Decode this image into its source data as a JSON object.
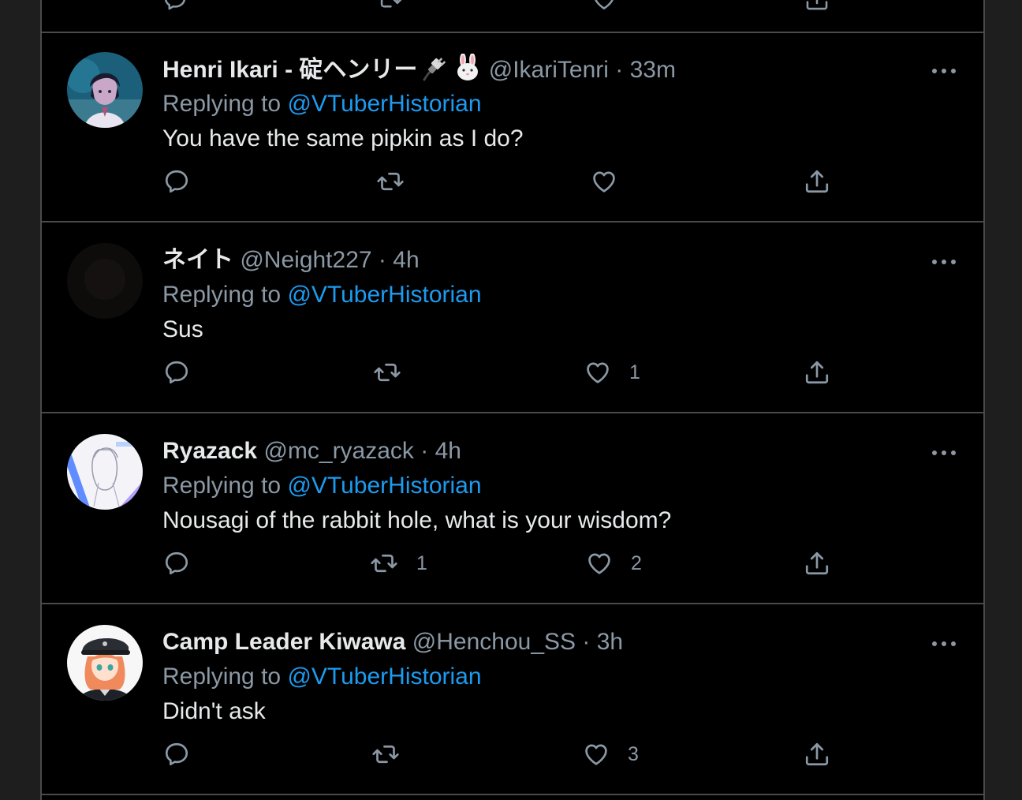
{
  "tweets": [
    {
      "display_name": "Henri Ikari - 碇ヘンリー",
      "emojis": [
        "plug-emoji",
        "rabbit-face-emoji"
      ],
      "handle": "@IkariTenri",
      "sep": "·",
      "time": "33m",
      "replying_prefix": "Replying to",
      "replying_to": "@VTuberHistorian",
      "text": "You have the same pipkin as I do?",
      "reply_count": "",
      "retweet_count": "",
      "like_count": ""
    },
    {
      "display_name": "ネイト",
      "handle": "@Neight227",
      "sep": "·",
      "time": "4h",
      "replying_prefix": "Replying to",
      "replying_to": "@VTuberHistorian",
      "text": "Sus",
      "reply_count": "",
      "retweet_count": "",
      "like_count": "1"
    },
    {
      "display_name": "Ryazack",
      "handle": "@mc_ryazack",
      "sep": "·",
      "time": "4h",
      "replying_prefix": "Replying to",
      "replying_to": "@VTuberHistorian",
      "text": "Nousagi of the rabbit hole, what is your wisdom?",
      "reply_count": "",
      "retweet_count": "1",
      "like_count": "2"
    },
    {
      "display_name": "Camp Leader Kiwawa",
      "handle": "@Henchou_SS",
      "sep": "·",
      "time": "3h",
      "replying_prefix": "Replying to",
      "replying_to": "@VTuberHistorian",
      "text": "Didn't ask",
      "reply_count": "",
      "retweet_count": "",
      "like_count": "3"
    }
  ],
  "colors": {
    "background": "#000000",
    "page_gutter": "#1e1e1e",
    "divider": "#4a4a4a",
    "primary_text": "#e7e9ea",
    "secondary_text": "#8b98a5",
    "mention": "#1d9bf0"
  },
  "icons": {
    "reply": "reply-icon",
    "retweet": "retweet-icon",
    "like": "like-icon",
    "share": "share-icon",
    "more": "more-icon"
  }
}
